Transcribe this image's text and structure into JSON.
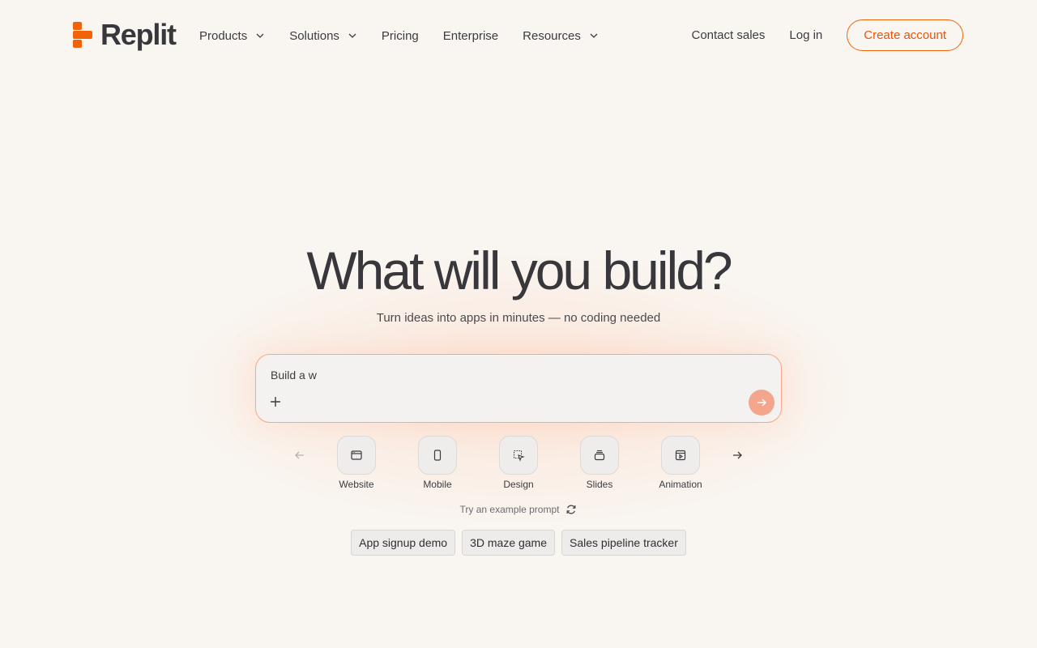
{
  "brand": {
    "name": "Replit",
    "accent": "#f26207"
  },
  "nav": {
    "items": [
      {
        "label": "Products",
        "dropdown": true
      },
      {
        "label": "Solutions",
        "dropdown": true
      },
      {
        "label": "Pricing",
        "dropdown": false
      },
      {
        "label": "Enterprise",
        "dropdown": false
      },
      {
        "label": "Resources",
        "dropdown": true
      }
    ],
    "contact": "Contact sales",
    "login": "Log in",
    "signup": "Create account"
  },
  "hero": {
    "title": "What will you build?",
    "subtitle": "Turn ideas into apps in minutes — no coding needed"
  },
  "prompt": {
    "value": "Build a w",
    "add_icon": "plus-icon",
    "send_icon": "arrow-right-icon"
  },
  "categories": [
    {
      "label": "Website",
      "icon": "browser-icon"
    },
    {
      "label": "Mobile",
      "icon": "phone-icon"
    },
    {
      "label": "Design",
      "icon": "cursor-select-icon"
    },
    {
      "label": "Slides",
      "icon": "slides-icon"
    },
    {
      "label": "Animation",
      "icon": "play-frame-icon"
    }
  ],
  "examples": {
    "label": "Try an example prompt",
    "chips": [
      "App signup demo",
      "3D maze game",
      "Sales pipeline tracker"
    ]
  }
}
